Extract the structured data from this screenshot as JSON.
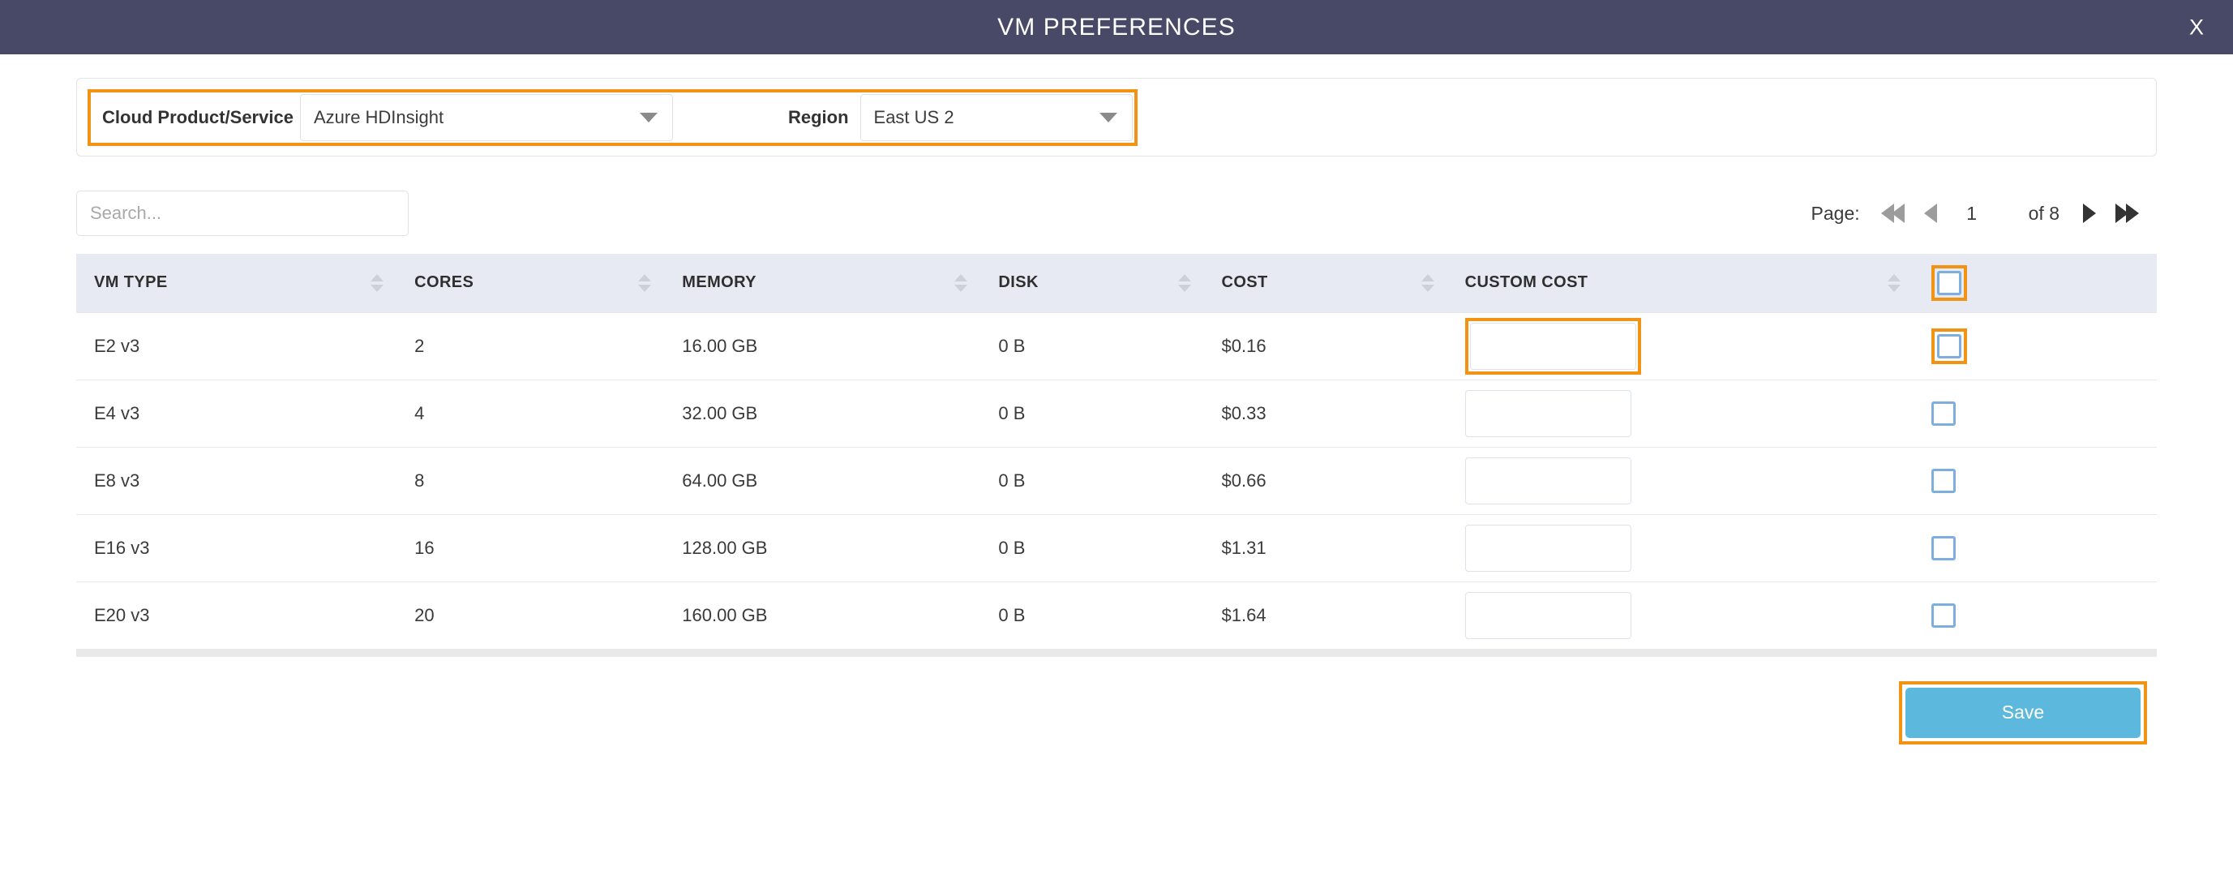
{
  "window": {
    "title": "VM PREFERENCES",
    "close_label": "X",
    "header_bg": "#474966",
    "accent_highlight": "#f39313",
    "save_button_color": "#5cb8dd",
    "checkbox_border_color": "#7eaee0"
  },
  "filters": {
    "product": {
      "label": "Cloud Product/Service",
      "value": "Azure HDInsight"
    },
    "region": {
      "label": "Region",
      "value": "East US 2"
    }
  },
  "search": {
    "placeholder": "Search...",
    "value": ""
  },
  "pagination": {
    "label": "Page:",
    "current_page": "1",
    "of_text": "of 8",
    "total_pages": 8,
    "first_icon": "double-chevron-left-icon",
    "prev_icon": "chevron-left-icon",
    "next_icon": "chevron-right-icon",
    "last_icon": "double-chevron-right-icon"
  },
  "table": {
    "columns": [
      {
        "key": "vm_type",
        "label": "VM TYPE",
        "sortable": true
      },
      {
        "key": "cores",
        "label": "CORES",
        "sortable": true
      },
      {
        "key": "memory",
        "label": "MEMORY",
        "sortable": true
      },
      {
        "key": "disk",
        "label": "DISK",
        "sortable": true
      },
      {
        "key": "cost",
        "label": "COST",
        "sortable": true
      },
      {
        "key": "custom_cost",
        "label": "CUSTOM COST",
        "sortable": true
      },
      {
        "key": "select",
        "label": "",
        "sortable": true
      }
    ],
    "select_all_checked": false,
    "rows": [
      {
        "vm_type": "E2 v3",
        "cores": "2",
        "memory": "16.00 GB",
        "disk": "0 B",
        "cost": "$0.16",
        "custom_cost": "",
        "selected": false,
        "highlighted": true
      },
      {
        "vm_type": "E4 v3",
        "cores": "4",
        "memory": "32.00 GB",
        "disk": "0 B",
        "cost": "$0.33",
        "custom_cost": "",
        "selected": false,
        "highlighted": false
      },
      {
        "vm_type": "E8 v3",
        "cores": "8",
        "memory": "64.00 GB",
        "disk": "0 B",
        "cost": "$0.66",
        "custom_cost": "",
        "selected": false,
        "highlighted": false
      },
      {
        "vm_type": "E16 v3",
        "cores": "16",
        "memory": "128.00 GB",
        "disk": "0 B",
        "cost": "$1.31",
        "custom_cost": "",
        "selected": false,
        "highlighted": false
      },
      {
        "vm_type": "E20 v3",
        "cores": "20",
        "memory": "160.00 GB",
        "disk": "0 B",
        "cost": "$1.64",
        "custom_cost": "",
        "selected": false,
        "highlighted": false
      }
    ]
  },
  "actions": {
    "save_label": "Save"
  }
}
